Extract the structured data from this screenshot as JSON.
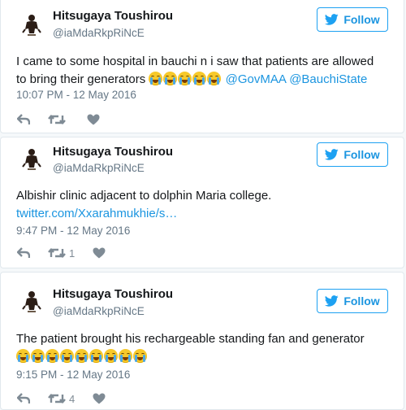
{
  "colors": {
    "accent": "#1da1f2",
    "link": "#1b95e0",
    "muted": "#657786",
    "emoji": "#f7c92b"
  },
  "tweets": [
    {
      "name": "Hitsugaya Toushirou",
      "handle": "@iaMdaRkpRiNcE",
      "follow_label": "Follow",
      "text_line1": "I came to some hospital in bauchi n i saw that patients are allowed",
      "text_line2_start": "to bring their generators",
      "emojis": [
        "loudly-crying-face",
        "loudly-crying-face",
        "loudly-crying-face",
        "loudly-crying-face",
        "loudly-crying-face"
      ],
      "mention1": "@GovMAA",
      "mention2": "@BauchiState",
      "time": "10:07 PM - 12 May 2016",
      "retweet_count": "",
      "like_count": ""
    },
    {
      "name": "Hitsugaya Toushirou",
      "handle": "@iaMdaRkpRiNcE",
      "follow_label": "Follow",
      "text_line1": "Albishir clinic adjacent to dolphin Maria college.",
      "link": "twitter.com/Xxarahmukhie/s…",
      "time": "9:47 PM - 12 May 2016",
      "retweet_count": "1",
      "like_count": ""
    },
    {
      "name": "Hitsugaya Toushirou",
      "handle": "@iaMdaRkpRiNcE",
      "follow_label": "Follow",
      "text_line1": "The patient brought his rechargeable standing fan and generator",
      "emojis": [
        "loudly-crying-face",
        "loudly-crying-face",
        "loudly-crying-face",
        "loudly-crying-face",
        "loudly-crying-face",
        "face-with-tears-of-joy",
        "face-with-tears-of-joy",
        "face-with-tears-of-joy",
        "face-with-tears-of-joy"
      ],
      "time": "9:15 PM - 12 May 2016",
      "retweet_count": "4",
      "like_count": ""
    }
  ]
}
